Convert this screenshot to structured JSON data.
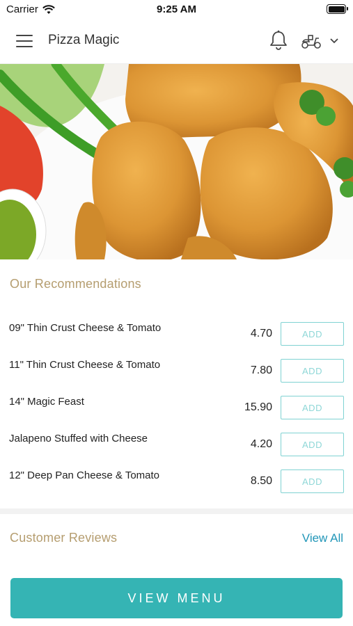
{
  "status_bar": {
    "carrier": "Carrier",
    "time": "9:25 AM"
  },
  "header": {
    "title": "Pizza Magic"
  },
  "hero": {
    "image": "chicken nuggets with green chilli, tomato, coriander and green chutney"
  },
  "recommendations": {
    "title": "Our Recommendations",
    "items": [
      {
        "name": "09\" Thin Crust Cheese & Tomato",
        "price": "4.70",
        "button": "ADD"
      },
      {
        "name": "11\" Thin Crust Cheese & Tomato",
        "price": "7.80",
        "button": "ADD"
      },
      {
        "name": "14\" Magic Feast",
        "price": "15.90",
        "button": "ADD"
      },
      {
        "name": "Jalapeno Stuffed with Cheese",
        "price": "4.20",
        "button": "ADD"
      },
      {
        "name": "12\" Deep Pan Cheese & Tomato",
        "price": "8.50",
        "button": "ADD"
      }
    ]
  },
  "reviews": {
    "title": "Customer Reviews",
    "view_all": "View All"
  },
  "footer": {
    "view_menu": "VIEW MENU"
  },
  "colors": {
    "accent": "#35b4b4",
    "section_title": "#b59d6f",
    "link": "#2196b8",
    "add_border": "#7fd2d2"
  },
  "icons": [
    "wifi-icon",
    "battery-icon",
    "hamburger-menu-icon",
    "bell-icon",
    "scooter-icon",
    "chevron-down-icon"
  ]
}
